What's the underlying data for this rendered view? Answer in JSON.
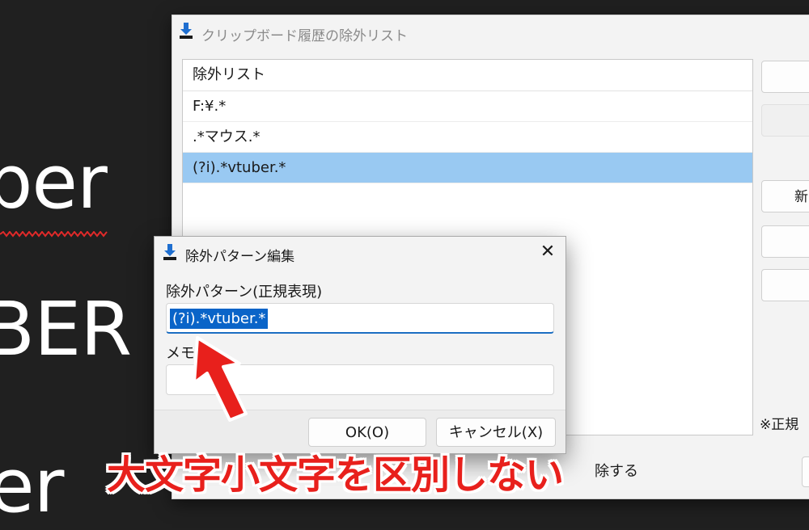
{
  "background_text": [
    "ber",
    "BER",
    "er"
  ],
  "main_window": {
    "title": "クリップボード履歴の除外リスト",
    "list_header": "除外リスト",
    "rows": [
      "F:¥.*",
      ".*マウス.*",
      "(?i).*vtuber.*"
    ],
    "selected_row": 2,
    "side_buttons": [
      "",
      "",
      "新",
      "",
      ""
    ],
    "note": "※正規",
    "checkbox_label_partial": "除する"
  },
  "dialog": {
    "title": "除外パターン編集",
    "close_symbol": "✕",
    "pattern_label": "除外パターン(正規表現)",
    "pattern_value": "(?i).*vtuber.*",
    "memo_label": "メモ",
    "memo_value": "",
    "ok_label": "OK(O)",
    "cancel_label": "キャンセル(X)"
  },
  "annotation": {
    "text": "大文字小文字を区別しない",
    "color": "#e8201c"
  },
  "colors": {
    "selection": "#99c9f2",
    "text_selection": "#0a64c8",
    "focus_underline": "#1b6ec2"
  }
}
